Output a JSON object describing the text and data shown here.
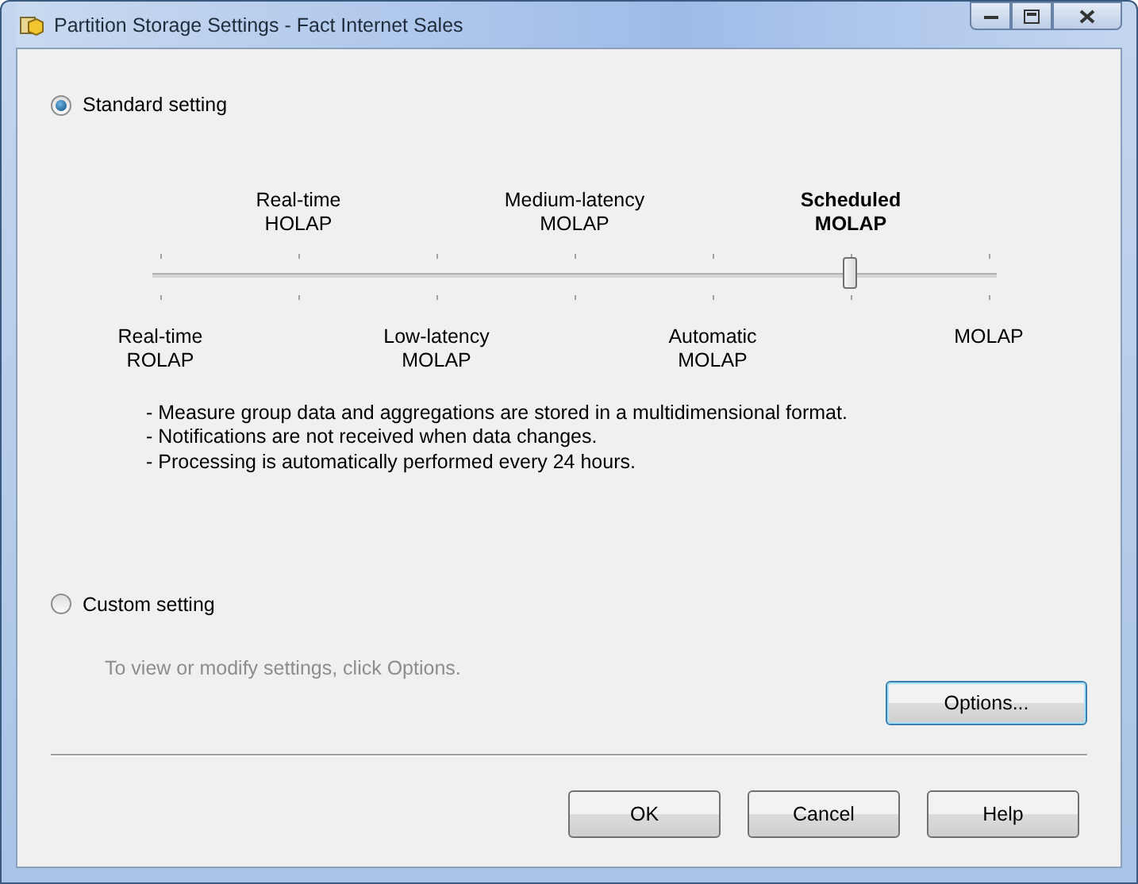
{
  "window": {
    "title": "Partition Storage Settings - Fact Internet Sales"
  },
  "standard": {
    "label": "Standard setting",
    "selected": true
  },
  "slider": {
    "level": 0.8333,
    "stops": [
      {
        "lines": [
          "Real-time",
          "ROLAP"
        ],
        "selected": false
      },
      {
        "lines": [
          "Real-time",
          "HOLAP"
        ],
        "selected": false
      },
      {
        "lines": [
          "Low-latency",
          "MOLAP"
        ],
        "selected": false
      },
      {
        "lines": [
          "Medium-latency",
          "MOLAP"
        ],
        "selected": false
      },
      {
        "lines": [
          "Automatic",
          "MOLAP"
        ],
        "selected": false
      },
      {
        "lines": [
          "Scheduled",
          "MOLAP"
        ],
        "selected": true
      },
      {
        "lines": [
          "MOLAP"
        ],
        "selected": false
      }
    ]
  },
  "description": [
    "- Measure group data and aggregations are stored in a multidimensional format.",
    "- Notifications are not received when data changes.",
    "- Processing is automatically performed every 24 hours."
  ],
  "custom": {
    "label": "Custom setting",
    "selected": false
  },
  "custom_hint": "To view or modify settings, click Options.",
  "options_button": "Options...",
  "buttons": [
    "OK",
    "Cancel",
    "Help"
  ]
}
